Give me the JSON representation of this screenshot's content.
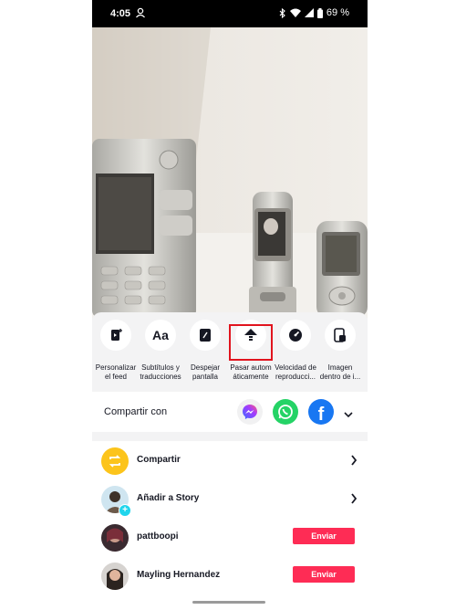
{
  "status_bar": {
    "time": "4:05",
    "battery": "69 %"
  },
  "actions": [
    {
      "label_line1": "Personalizar",
      "label_line2": "el feed",
      "icon": "personalize-feed-icon"
    },
    {
      "label_line1": "Subtítulos y",
      "label_line2": "traducciones",
      "icon": "captions-icon",
      "glyph": "Aa"
    },
    {
      "label_line1": "Despejar",
      "label_line2": "pantalla",
      "icon": "clear-screen-icon"
    },
    {
      "label_line1": "Pasar autom",
      "label_line2": "áticamente",
      "icon": "auto-scroll-icon"
    },
    {
      "label_line1": "Velocidad de",
      "label_line2": "reproducci...",
      "icon": "speed-icon"
    },
    {
      "label_line1": "Imagen",
      "label_line2": "dentro de i...",
      "icon": "picture-in-picture-icon"
    }
  ],
  "share": {
    "title": "Compartir con",
    "apps": [
      "messenger-icon",
      "whatsapp-icon",
      "facebook-icon"
    ]
  },
  "rows": [
    {
      "label": "Compartir",
      "type": "chevron"
    },
    {
      "label": "Añadir a Story",
      "type": "chevron"
    },
    {
      "label": "pattboopi",
      "type": "send",
      "button": "Enviar"
    },
    {
      "label": "Mayling Hernandez",
      "type": "send",
      "button": "Enviar"
    }
  ],
  "colors": {
    "accent": "#fe2c55",
    "highlight": "#e1141e",
    "whatsapp": "#25d366",
    "facebook": "#1877f2"
  }
}
